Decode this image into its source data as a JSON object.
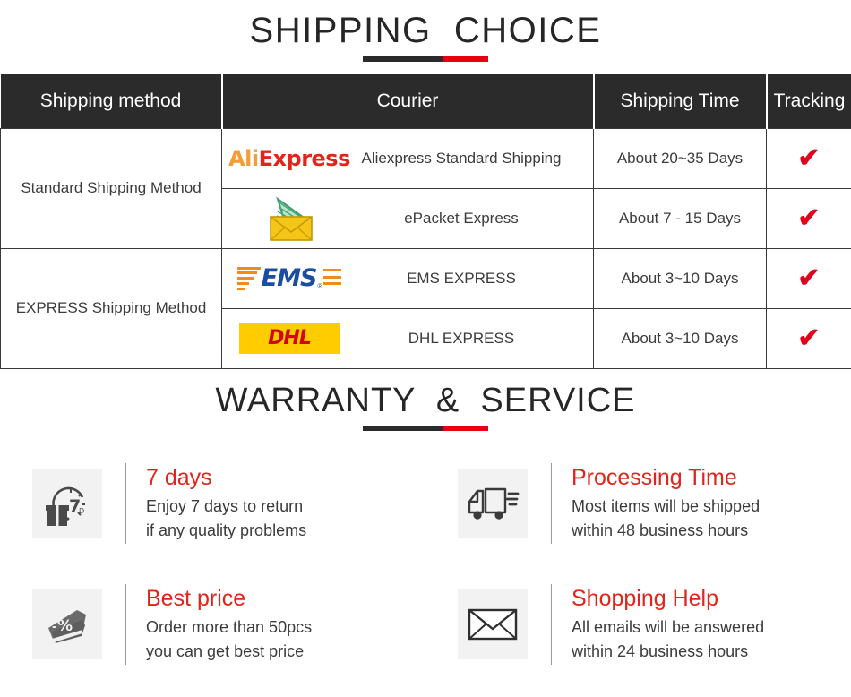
{
  "shipping": {
    "title": "SHIPPING  CHOICE",
    "accent_dark": "#2b2b2b",
    "accent_red": "#e60012",
    "columns": [
      "Shipping method",
      "Courier",
      "Shipping Time",
      "Tracking"
    ],
    "rows": [
      {
        "method": "Standard Shipping Method",
        "method_rowspan": 2,
        "logo": "aliexpress-logo",
        "courier": "Aliexpress Standard Shipping",
        "time": "About 20~35 Days",
        "tracking": "check-icon"
      },
      {
        "method": "",
        "method_rowspan": 0,
        "logo": "epacket-envelope-logo",
        "courier": "ePacket Express",
        "time": "About 7 - 15 Days",
        "tracking": "check-icon"
      },
      {
        "method": "EXPRESS Shipping Method",
        "method_rowspan": 2,
        "logo": "ems-logo",
        "courier": "EMS EXPRESS",
        "time": "About 3~10 Days",
        "tracking": "check-icon"
      },
      {
        "method": "",
        "method_rowspan": 0,
        "logo": "dhl-logo",
        "courier": "DHL EXPRESS",
        "time": "About 3~10 Days",
        "tracking": "check-icon"
      }
    ],
    "logos": {
      "aliexpress": {
        "part1": "Ali",
        "part2": "Express",
        "color1": "#f19e38",
        "color2": "#e1251b"
      },
      "ems": {
        "text": "EMS",
        "color": "#1b4ea0",
        "stripe_color": "#f08c1e",
        "registered": "®"
      },
      "dhl": {
        "text": "DHL",
        "color": "#d40511",
        "background": "#ffcc00"
      }
    },
    "check_glyph": "✔",
    "check_color": "#e2001a"
  },
  "warranty": {
    "title": "WARRANTY  &  SERVICE",
    "features": [
      {
        "icon": "gift-clock-7day-icon",
        "title": "7 days",
        "lines": [
          "Enjoy 7 days to return",
          "if any quality problems"
        ]
      },
      {
        "icon": "delivery-truck-icon",
        "title": "Processing Time",
        "lines": [
          "Most items will be shipped",
          "within 48 business hours"
        ]
      },
      {
        "icon": "discount-tag-icon",
        "title": "Best price",
        "lines": [
          "Order more than 50pcs",
          "you can get best price"
        ]
      },
      {
        "icon": "envelope-icon",
        "title": "Shopping Help",
        "lines": [
          "All emails will be answered",
          "within 24 business hours"
        ]
      }
    ],
    "title_color": "#e1251b",
    "text_color": "#3c3c3c"
  }
}
